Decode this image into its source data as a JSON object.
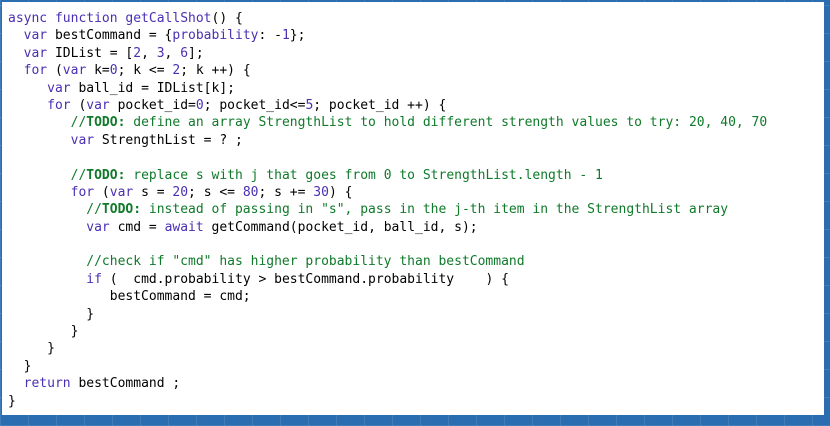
{
  "editor": {
    "language": "javascript",
    "colors": {
      "keyword": "#4b2fb3",
      "comment": "#0f7a2a",
      "background": "#ffffff",
      "frame": "#2a6db0"
    },
    "lines": [
      [
        {
          "t": "async function ",
          "c": "kw"
        },
        {
          "t": "getCallShot",
          "c": "fn"
        },
        {
          "t": "() {",
          "c": "st"
        }
      ],
      [
        {
          "t": "  ",
          "c": "st"
        },
        {
          "t": "var",
          "c": "kw"
        },
        {
          "t": " bestCommand = {",
          "c": "st"
        },
        {
          "t": "probability",
          "c": "kw"
        },
        {
          "t": ": -",
          "c": "st"
        },
        {
          "t": "1",
          "c": "num"
        },
        {
          "t": "};",
          "c": "st"
        }
      ],
      [
        {
          "t": "  ",
          "c": "st"
        },
        {
          "t": "var",
          "c": "kw"
        },
        {
          "t": " IDList = [",
          "c": "st"
        },
        {
          "t": "2",
          "c": "num"
        },
        {
          "t": ", ",
          "c": "st"
        },
        {
          "t": "3",
          "c": "num"
        },
        {
          "t": ", ",
          "c": "st"
        },
        {
          "t": "6",
          "c": "num"
        },
        {
          "t": "];",
          "c": "st"
        }
      ],
      [
        {
          "t": "  ",
          "c": "st"
        },
        {
          "t": "for",
          "c": "kw"
        },
        {
          "t": " (",
          "c": "st"
        },
        {
          "t": "var",
          "c": "kw"
        },
        {
          "t": " k=",
          "c": "st"
        },
        {
          "t": "0",
          "c": "num"
        },
        {
          "t": "; k <= ",
          "c": "st"
        },
        {
          "t": "2",
          "c": "num"
        },
        {
          "t": "; k ++) {",
          "c": "st"
        }
      ],
      [
        {
          "t": "     ",
          "c": "st"
        },
        {
          "t": "var",
          "c": "kw"
        },
        {
          "t": " ball_id = IDList[k];",
          "c": "st"
        }
      ],
      [
        {
          "t": "     ",
          "c": "st"
        },
        {
          "t": "for",
          "c": "kw"
        },
        {
          "t": " (",
          "c": "st"
        },
        {
          "t": "var",
          "c": "kw"
        },
        {
          "t": " pocket_id=",
          "c": "st"
        },
        {
          "t": "0",
          "c": "num"
        },
        {
          "t": "; pocket_id<=",
          "c": "st"
        },
        {
          "t": "5",
          "c": "num"
        },
        {
          "t": "; pocket_id ++) {",
          "c": "st"
        }
      ],
      [
        {
          "t": "        //",
          "c": "cm"
        },
        {
          "t": "TODO:",
          "c": "todo"
        },
        {
          "t": " define an array StrengthList to hold different strength values to try: 20, 40, 70",
          "c": "cm"
        }
      ],
      [
        {
          "t": "        ",
          "c": "st"
        },
        {
          "t": "var",
          "c": "kw"
        },
        {
          "t": " StrengthList = ? ;",
          "c": "st"
        }
      ],
      [
        {
          "t": "",
          "c": "st"
        }
      ],
      [
        {
          "t": "        //",
          "c": "cm"
        },
        {
          "t": "TODO:",
          "c": "todo"
        },
        {
          "t": " replace s with j that goes from 0 to StrengthList.length - 1",
          "c": "cm"
        }
      ],
      [
        {
          "t": "        ",
          "c": "st"
        },
        {
          "t": "for",
          "c": "kw"
        },
        {
          "t": " (",
          "c": "st"
        },
        {
          "t": "var",
          "c": "kw"
        },
        {
          "t": " s = ",
          "c": "st"
        },
        {
          "t": "20",
          "c": "num"
        },
        {
          "t": "; s <= ",
          "c": "st"
        },
        {
          "t": "80",
          "c": "num"
        },
        {
          "t": "; s += ",
          "c": "st"
        },
        {
          "t": "30",
          "c": "num"
        },
        {
          "t": ") {",
          "c": "st"
        }
      ],
      [
        {
          "t": "          //",
          "c": "cm"
        },
        {
          "t": "TODO:",
          "c": "todo"
        },
        {
          "t": " instead of passing in \"s\", pass in the j-th item in the StrengthList array",
          "c": "cm"
        }
      ],
      [
        {
          "t": "          ",
          "c": "st"
        },
        {
          "t": "var",
          "c": "kw"
        },
        {
          "t": " cmd = ",
          "c": "st"
        },
        {
          "t": "await",
          "c": "kw"
        },
        {
          "t": " getCommand(pocket_id, ball_id, s);",
          "c": "st"
        }
      ],
      [
        {
          "t": "",
          "c": "st"
        }
      ],
      [
        {
          "t": "          //check if \"cmd\" has higher probability than bestCommand",
          "c": "cm"
        }
      ],
      [
        {
          "t": "          ",
          "c": "st"
        },
        {
          "t": "if",
          "c": "kw"
        },
        {
          "t": " (  cmd.probability > bestCommand.probability    ) {",
          "c": "st"
        }
      ],
      [
        {
          "t": "             bestCommand = cmd;",
          "c": "st"
        }
      ],
      [
        {
          "t": "          }",
          "c": "st"
        }
      ],
      [
        {
          "t": "        }",
          "c": "st"
        }
      ],
      [
        {
          "t": "     }",
          "c": "st"
        }
      ],
      [
        {
          "t": "  }",
          "c": "st"
        }
      ],
      [
        {
          "t": "  ",
          "c": "st"
        },
        {
          "t": "return",
          "c": "kw"
        },
        {
          "t": " bestCommand ;",
          "c": "st"
        }
      ],
      [
        {
          "t": "}",
          "c": "st"
        }
      ]
    ]
  }
}
